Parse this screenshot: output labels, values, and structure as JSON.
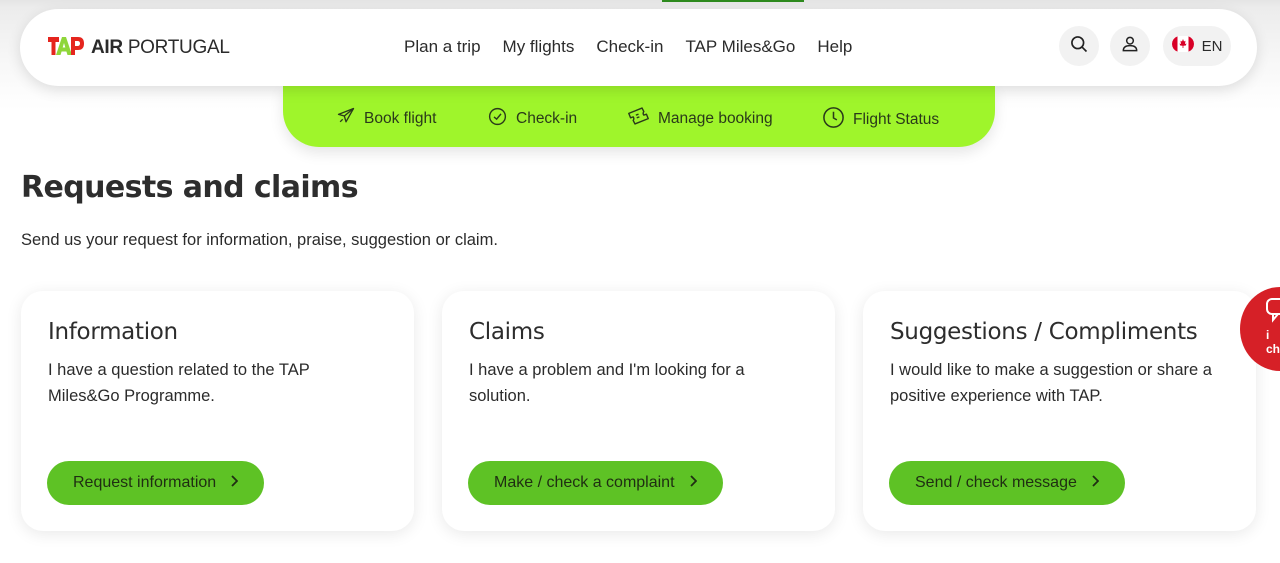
{
  "brand": {
    "logo_text_bold": "AIR",
    "logo_text": "PORTUGAL",
    "accent_green": "#9ff52b",
    "button_green": "#5ec225",
    "logo_red": "#e5251e"
  },
  "main_nav": {
    "items": [
      "Plan a trip",
      "My flights",
      "Check-in",
      "TAP Miles&Go",
      "Help"
    ]
  },
  "header_actions": {
    "search_icon": "search-icon",
    "account_icon": "user-icon",
    "language": "EN",
    "flag_icon": "canada-flag-icon"
  },
  "sub_nav": {
    "items": [
      {
        "label": "Book flight",
        "icon": "plane-icon"
      },
      {
        "label": "Check-in",
        "icon": "check-circle-icon"
      },
      {
        "label": "Manage booking",
        "icon": "ticket-icon"
      },
      {
        "label": "Flight Status",
        "icon": "clock-icon"
      }
    ]
  },
  "page": {
    "title": "Requests and claims",
    "subtitle": "Send us your request for information, praise, suggestion or claim."
  },
  "cards": [
    {
      "title": "Information",
      "text": "I have a question related to the TAP Miles&Go Programme.",
      "button": "Request information"
    },
    {
      "title": "Claims",
      "text": "I have a problem and I'm looking for a solution.",
      "button": "Make / check a complaint"
    },
    {
      "title": "Suggestions / Compliments",
      "text": "I would like to make a suggestion or share a positive experience with TAP.",
      "button": "Send / check message"
    }
  ],
  "chat": {
    "label_line1": "i",
    "label_line2": "ch",
    "color": "#d62027"
  }
}
